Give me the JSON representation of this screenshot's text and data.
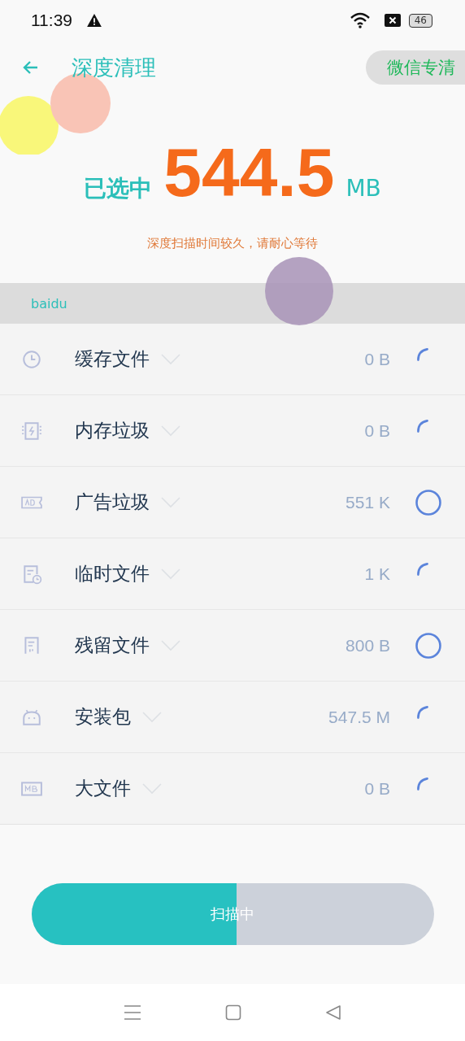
{
  "status_bar": {
    "time": "11:39",
    "battery": "46"
  },
  "header": {
    "title": "深度清理",
    "action": "微信专清"
  },
  "summary": {
    "prefix": "已选中",
    "amount": "544.5",
    "unit": "MB",
    "hint": "深度扫描时间较久，请耐心等待"
  },
  "group": {
    "label": "baidu"
  },
  "items": [
    {
      "name": "缓存文件",
      "size": "0 B",
      "scanning": true
    },
    {
      "name": "内存垃圾",
      "size": "0 B",
      "scanning": true
    },
    {
      "name": "广告垃圾",
      "size": "551 K",
      "scanning": false
    },
    {
      "name": "临时文件",
      "size": "1 K",
      "scanning": true
    },
    {
      "name": "残留文件",
      "size": "800 B",
      "scanning": false
    },
    {
      "name": "安装包",
      "size": "547.5 M",
      "scanning": true
    },
    {
      "name": "大文件",
      "size": "0 B",
      "scanning": true
    }
  ],
  "scan_button": {
    "label": "扫描中",
    "level": 0.51
  }
}
